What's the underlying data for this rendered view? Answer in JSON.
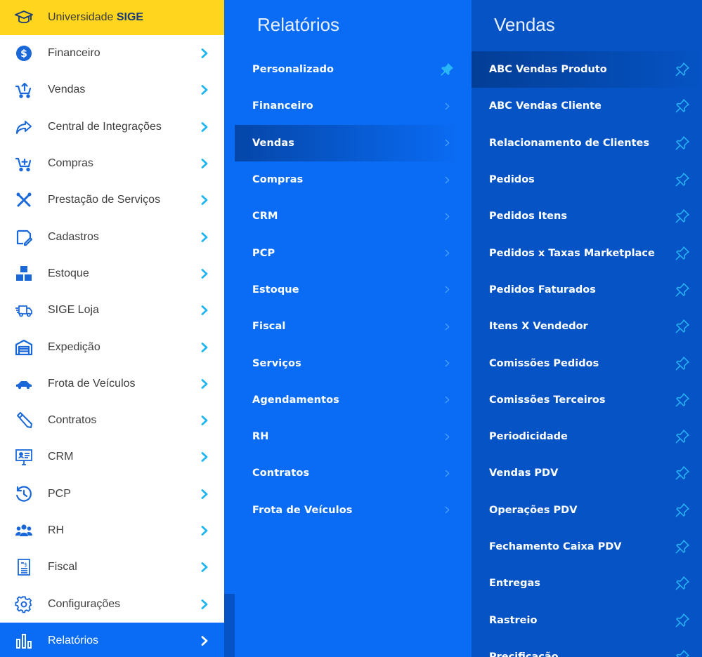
{
  "brand": {
    "prefix": "Universidade ",
    "name": "SIGE",
    "icon": "graduation-cap-icon"
  },
  "sidebar": {
    "items": [
      {
        "label": "Financeiro",
        "icon": "dollar-icon"
      },
      {
        "label": "Vendas",
        "icon": "cart-up-icon"
      },
      {
        "label": "Central de Integrações",
        "icon": "share-arrow-icon"
      },
      {
        "label": "Compras",
        "icon": "cart-plus-icon"
      },
      {
        "label": "Prestação de Serviços",
        "icon": "tools-icon"
      },
      {
        "label": "Cadastros",
        "icon": "edit-note-icon"
      },
      {
        "label": "Estoque",
        "icon": "boxes-icon"
      },
      {
        "label": "SIGE Loja",
        "icon": "delivery-truck-icon"
      },
      {
        "label": "Expedição",
        "icon": "warehouse-icon"
      },
      {
        "label": "Frota de Veículos",
        "icon": "car-icon"
      },
      {
        "label": "Contratos",
        "icon": "pen-icon"
      },
      {
        "label": "CRM",
        "icon": "contact-screen-icon"
      },
      {
        "label": "PCP",
        "icon": "clock-history-icon"
      },
      {
        "label": "RH",
        "icon": "users-icon"
      },
      {
        "label": "Fiscal",
        "icon": "invoice-icon"
      },
      {
        "label": "Configurações",
        "icon": "gear-icon"
      },
      {
        "label": "Relatórios",
        "icon": "bar-chart-icon",
        "active": true
      }
    ]
  },
  "reports_panel": {
    "title": "Relatórios",
    "items": [
      {
        "label": "Personalizado",
        "pinned": true
      },
      {
        "label": "Financeiro"
      },
      {
        "label": "Vendas",
        "active": true
      },
      {
        "label": "Compras"
      },
      {
        "label": "CRM"
      },
      {
        "label": "PCP"
      },
      {
        "label": "Estoque"
      },
      {
        "label": "Fiscal"
      },
      {
        "label": "Serviços"
      },
      {
        "label": "Agendamentos"
      },
      {
        "label": "RH"
      },
      {
        "label": "Contratos"
      },
      {
        "label": "Frota de Veículos"
      }
    ]
  },
  "sales_panel": {
    "title": "Vendas",
    "items": [
      {
        "label": "ABC Vendas Produto",
        "active": true
      },
      {
        "label": "ABC Vendas Cliente"
      },
      {
        "label": "Relacionamento de Clientes"
      },
      {
        "label": "Pedidos"
      },
      {
        "label": "Pedidos Itens"
      },
      {
        "label": "Pedidos x Taxas Marketplace"
      },
      {
        "label": "Pedidos Faturados"
      },
      {
        "label": "Itens X Vendedor"
      },
      {
        "label": "Comissões Pedidos"
      },
      {
        "label": "Comissões Terceiros"
      },
      {
        "label": "Periodicidade"
      },
      {
        "label": "Vendas PDV"
      },
      {
        "label": "Operações PDV"
      },
      {
        "label": "Fechamento Caixa PDV"
      },
      {
        "label": "Entregas"
      },
      {
        "label": "Rastreio"
      },
      {
        "label": "Precificação"
      }
    ]
  },
  "colors": {
    "brand_bar": "#ffd51e",
    "accent_blue": "#0a6cf5",
    "dark_blue": "#0553c4",
    "icon_blue": "#1967d8",
    "chevron_cyan": "#1fb6f0",
    "pin_cyan": "#29b6f6"
  }
}
